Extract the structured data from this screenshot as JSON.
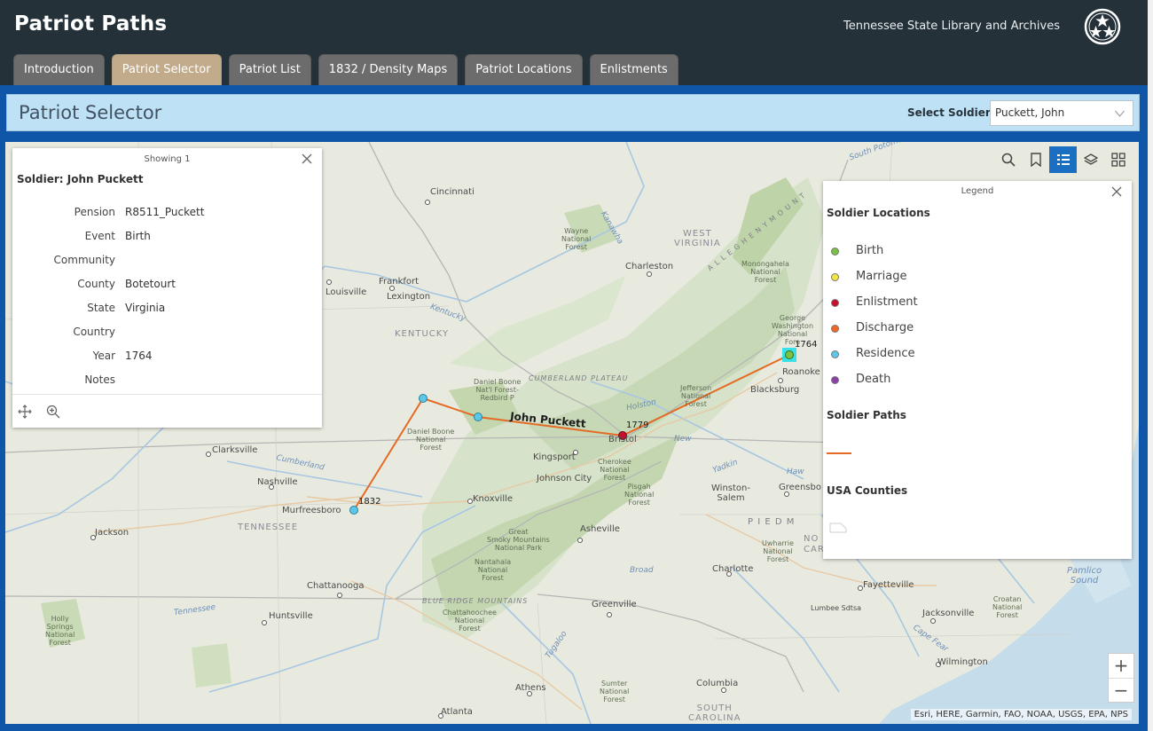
{
  "header": {
    "title": "Patriot Paths",
    "org": "Tennessee State Library and Archives"
  },
  "tabs": [
    {
      "label": "Introduction",
      "active": false
    },
    {
      "label": "Patriot Selector",
      "active": true
    },
    {
      "label": "Patriot List",
      "active": false
    },
    {
      "label": "1832 / Density Maps",
      "active": false
    },
    {
      "label": "Patriot Locations",
      "active": false
    },
    {
      "label": "Enlistments",
      "active": false
    }
  ],
  "page": {
    "title": "Patriot Selector",
    "select_label": "Select Soldier:",
    "selected_soldier": "Puckett, John"
  },
  "popup": {
    "header": "Showing 1",
    "title": "Soldier: John Puckett",
    "fields": [
      {
        "key": "Pension",
        "value": "R8511_Puckett"
      },
      {
        "key": "Event",
        "value": "Birth"
      },
      {
        "key": "Community",
        "value": ""
      },
      {
        "key": "County",
        "value": "Botetourt"
      },
      {
        "key": "State",
        "value": "Virginia"
      },
      {
        "key": "Country",
        "value": ""
      },
      {
        "key": "Year",
        "value": "1764"
      },
      {
        "key": "Notes",
        "value": ""
      }
    ]
  },
  "legend": {
    "header": "Legend",
    "locations_title": "Soldier Locations",
    "locations": [
      {
        "label": "Birth",
        "color": "#7cc242"
      },
      {
        "label": "Marriage",
        "color": "#f2e640"
      },
      {
        "label": "Enlistment",
        "color": "#c8102e"
      },
      {
        "label": "Discharge",
        "color": "#f26522"
      },
      {
        "label": "Residence",
        "color": "#5bc8ea"
      },
      {
        "label": "Death",
        "color": "#8e3fa8"
      }
    ],
    "paths_title": "Soldier Paths",
    "path_color": "#e46b26",
    "counties_title": "USA Counties"
  },
  "map": {
    "path_label": "John Puckett",
    "years": {
      "birth": "1764",
      "enlist": "1779",
      "death": "1832"
    },
    "attribution": "Esri, HERE, Garmin, FAO, NOAA, USGS, EPA, NPS",
    "cities": {
      "cincinnati": "Cincinnati",
      "louisville": "Louisville",
      "frankfort": "Frankfort",
      "lexington": "Lexington",
      "charleston": "Charleston",
      "roanoke": "Roanoke",
      "blacksburg": "Blacksburg",
      "bristol": "Bristol",
      "kingsport": "Kingsport",
      "johnson_city": "Johnson City",
      "knoxville": "Knoxville",
      "clarksville": "Clarksville",
      "nashville": "Nashville",
      "murfreesboro": "Murfreesboro",
      "jackson": "Jackson",
      "chattanooga": "Chattanooga",
      "huntsville": "Huntsville",
      "asheville": "Asheville",
      "greenville": "Greenville",
      "charlotte": "Charlotte",
      "winston_salem": "Winston-\nSalem",
      "greensboro": "Greensbo",
      "fayetteville": "Fayetteville",
      "jacksonville": "Jacksonville",
      "wilmington": "Wilmington",
      "columbia": "Columbia",
      "athens": "Athens",
      "atlanta": "Atlanta",
      "lumbee": "Lumbee Sdtsa"
    },
    "regions": {
      "west_virginia": "WEST\nVIRGINIA",
      "kentucky": "KENTUCKY",
      "tennessee": "TENNESSEE",
      "south_carolina": "SOUTH\nCAROLINA",
      "cumberland": "CUMBERLAND PLATEAU",
      "blue_ridge": "BLUE RIDGE MOUNTAINS",
      "piedmont": "P I E D M",
      "north_carolina": "NO\nCAR",
      "allegheny": "A L L E G H E N Y   M O U N T"
    },
    "parks": {
      "wayne": "Wayne\nNational\nForest",
      "monongahela": "Monongahela\nNational\nForest",
      "gwashington": "George\nWashington\nNational\nFore",
      "dboone_nf": "Daniel Boone\nNat'l Forest-\nRedbird P",
      "dboone": "Daniel Boone\nNational\nForest",
      "jefferson": "Jefferson\nNational\nForest",
      "cherokee": "Cherokee\nNational\nForest",
      "pisgah": "Pisgah\nNational\nForest",
      "smoky": "Great\nSmoky Mountains\nNational Park",
      "nantahala": "Nantahala\nNational\nForest",
      "chattahoochee": "Chattahoochee\nNational\nForest",
      "uwharrie": "Uwharrie\nNational\nForest",
      "croatan": "Croatan\nNational\nForest",
      "sumter": "Sumter\nNational\nForest",
      "holly": "Holly\nSprings\nNational\nForest"
    },
    "waters": {
      "kentucky_r": "Kentucky",
      "cumberland_r": "Cumberland",
      "tennessee_r": "Tennessee",
      "holston": "Holston",
      "new": "New",
      "yadkin": "Yadkin",
      "haw": "Haw",
      "broad": "Broad",
      "tugaloo": "Tugaloo",
      "cape_fear": "Cape Fear",
      "kanawha": "Kanawha",
      "pamlico": "Pamlico\nSound",
      "potomac": "South Potomac"
    }
  }
}
